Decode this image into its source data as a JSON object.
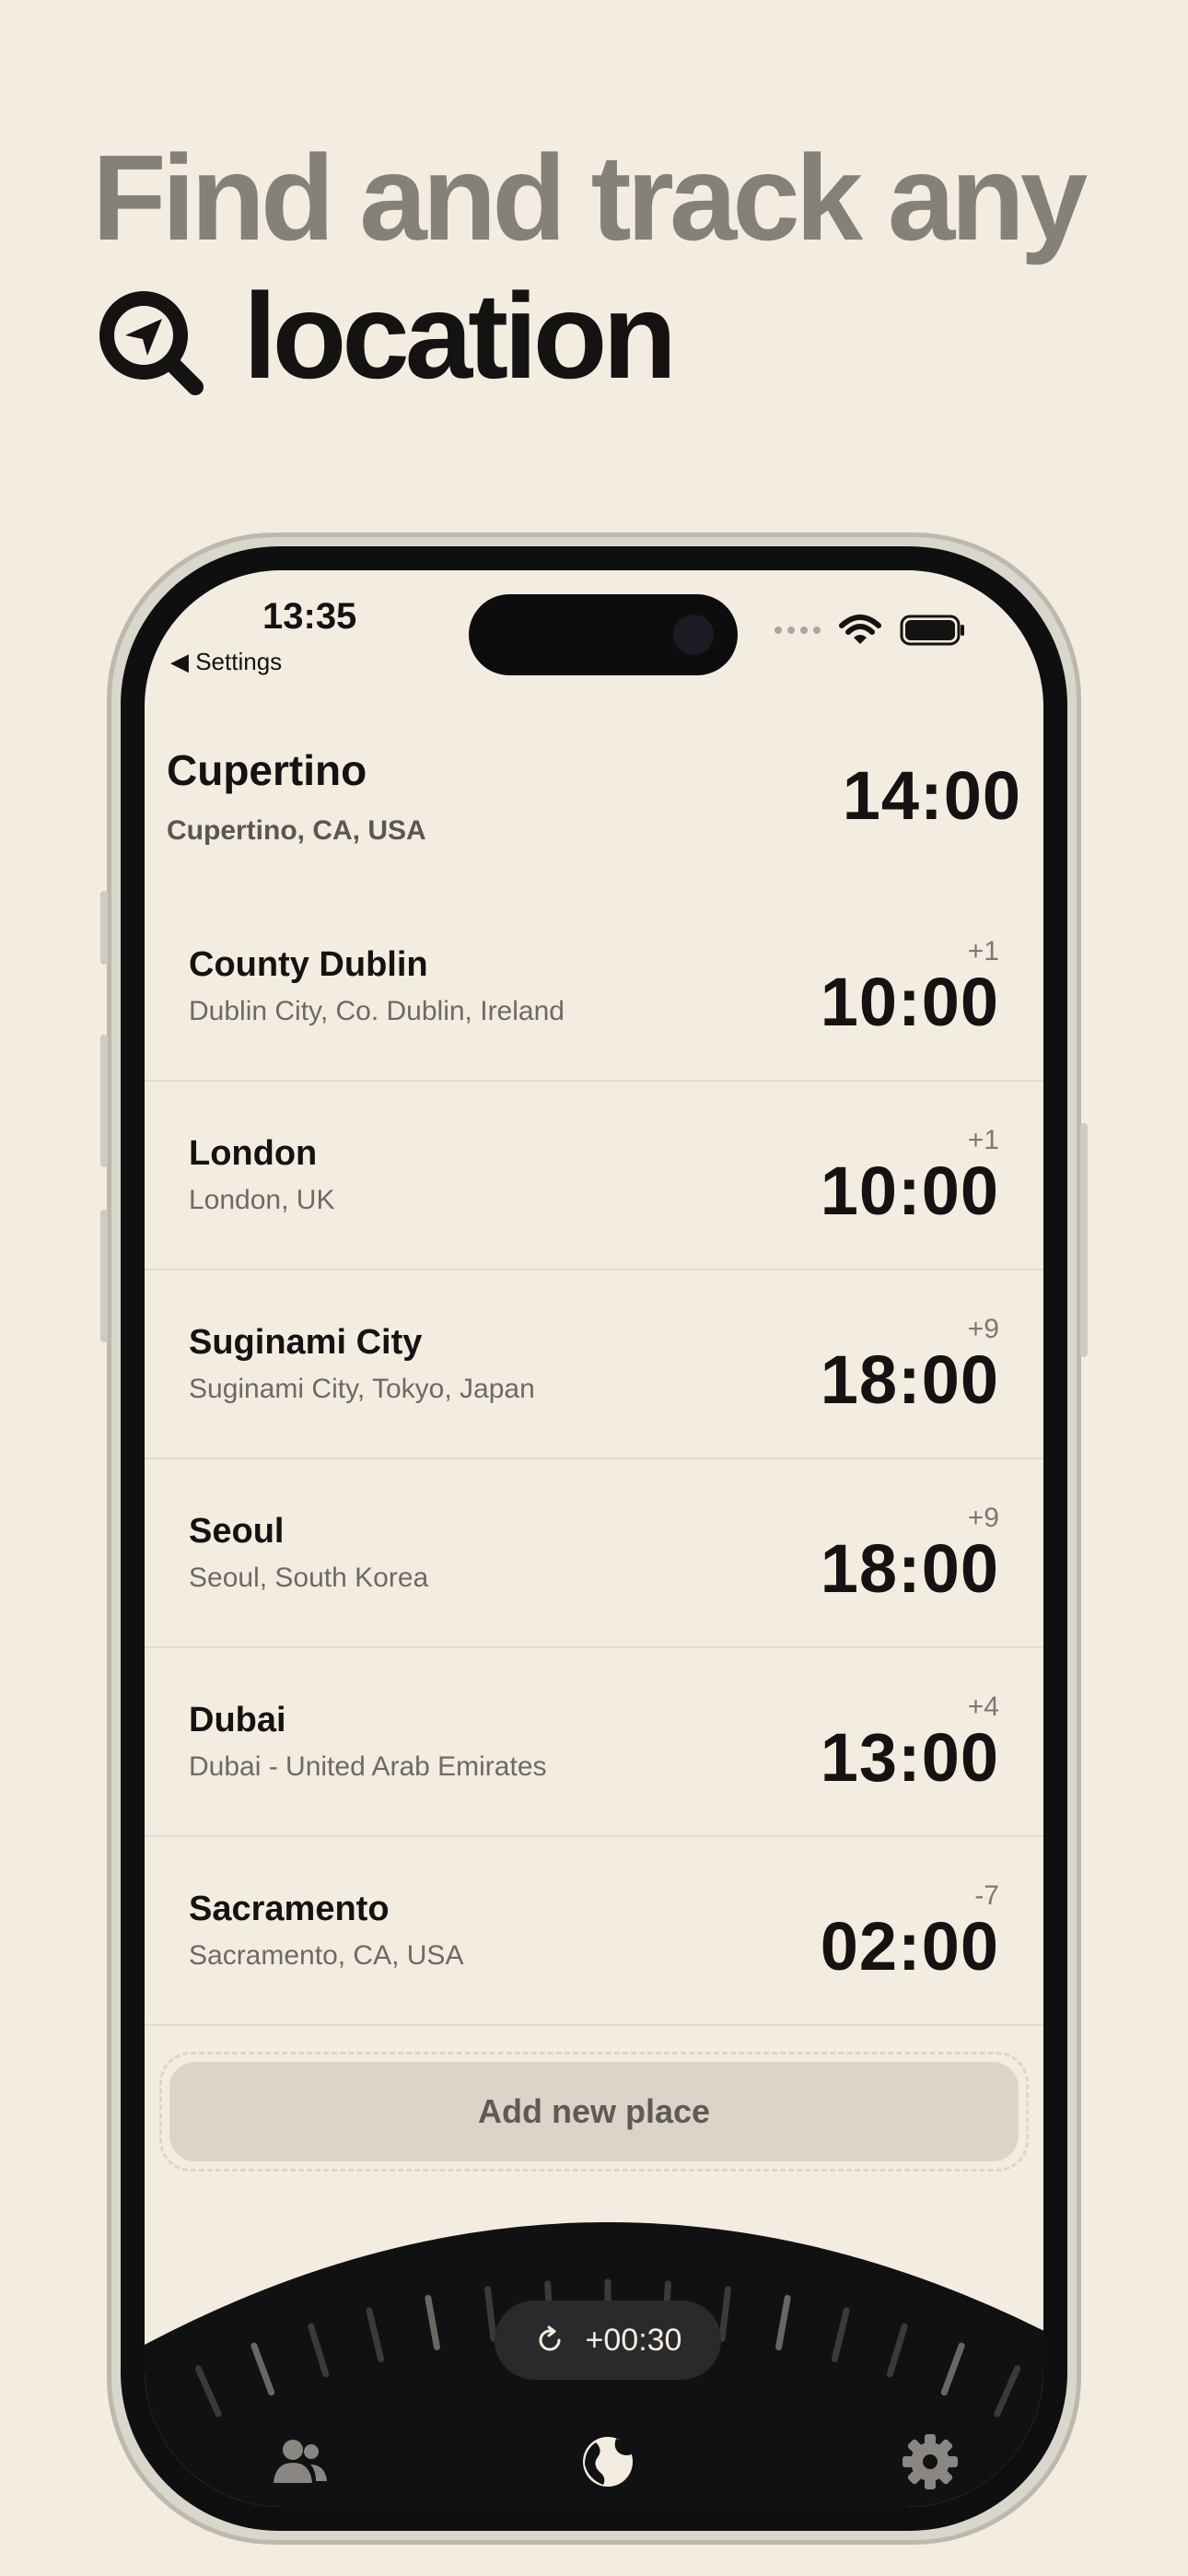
{
  "headline": {
    "line1": "Find and track any",
    "line2": "location"
  },
  "status_bar": {
    "time": "13:35",
    "back_label": "◀ Settings"
  },
  "home": {
    "name": "Cupertino",
    "subtitle": "Cupertino, CA, USA",
    "time": "14:00"
  },
  "places": [
    {
      "name": "County Dublin",
      "subtitle": "Dublin City, Co. Dublin, Ireland",
      "offset": "+1",
      "time": "10:00"
    },
    {
      "name": "London",
      "subtitle": "London, UK",
      "offset": "+1",
      "time": "10:00"
    },
    {
      "name": "Suginami City",
      "subtitle": "Suginami City, Tokyo, Japan",
      "offset": "+9",
      "time": "18:00"
    },
    {
      "name": "Seoul",
      "subtitle": "Seoul, South Korea",
      "offset": "+9",
      "time": "18:00"
    },
    {
      "name": "Dubai",
      "subtitle": "Dubai - United Arab Emirates",
      "offset": "+4",
      "time": "13:00"
    },
    {
      "name": "Sacramento",
      "subtitle": "Sacramento, CA, USA",
      "offset": "-7",
      "time": "02:00"
    }
  ],
  "add_button": {
    "label": "Add new place"
  },
  "time_offset": {
    "label": "+00:30"
  },
  "tabs": [
    {
      "icon": "people-icon"
    },
    {
      "icon": "globe-icon"
    },
    {
      "icon": "gear-icon"
    }
  ],
  "colors": {
    "background": "#f3ece0",
    "text": "#141312",
    "muted": "#84807a",
    "dial": "#111113"
  }
}
